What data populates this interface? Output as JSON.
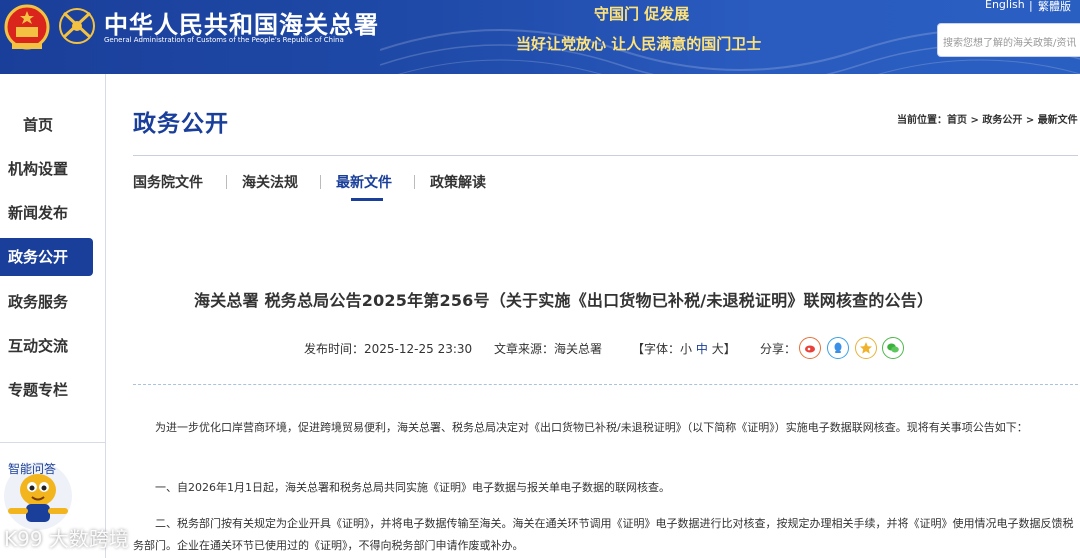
{
  "header": {
    "site_title": "中华人民共和国海关总署",
    "site_subtitle": "General Administration of Customs of the People's Republic of China",
    "slogan_top": "守国门  促发展",
    "slogan_bottom": "当好让党放心   让人民满意的国门卫士",
    "lang_english": "English",
    "lang_separator": "|",
    "lang_traditional": "繁體版",
    "search_placeholder": "搜索您想了解的海关政策/资讯"
  },
  "sidebar": {
    "items": [
      {
        "label": "首页"
      },
      {
        "label": "机构设置"
      },
      {
        "label": "新闻发布"
      },
      {
        "label": "政务公开",
        "active": true
      },
      {
        "label": "政务服务"
      },
      {
        "label": "互动交流"
      },
      {
        "label": "专题专栏"
      }
    ],
    "assistant_label": "智能问答"
  },
  "main": {
    "section_title": "政务公开",
    "breadcrumb": {
      "prefix": "当前位置：",
      "items": [
        "首页",
        "政务公开",
        "最新文件"
      ],
      "separator": " > "
    },
    "tabs": [
      {
        "label": "国务院文件"
      },
      {
        "label": "海关法规"
      },
      {
        "label": "最新文件",
        "active": true
      },
      {
        "label": "政策解读"
      }
    ]
  },
  "article": {
    "title": "海关总署 税务总局公告2025年第256号（关于实施《出口货物已补税/未退税证明》联网核查的公告）",
    "publish_time_label": "发布时间：",
    "publish_time": "2025-12-25 23:30",
    "source_label": "文章来源：",
    "source": "海关总署",
    "font_label": "【字体：",
    "font_small": "小",
    "font_medium": "中",
    "font_large": "大",
    "font_close": "】",
    "share_label": "分享：",
    "share_icons": [
      "weibo-icon",
      "qq-icon",
      "qzone-icon",
      "wechat-icon"
    ],
    "paragraphs": [
      "为进一步优化口岸营商环境，促进跨境贸易便利，海关总署、税务总局决定对《出口货物已补税/未退税证明》（以下简称《证明》）实施电子数据联网核查。现将有关事项公告如下：",
      "一、自2026年1月1日起，海关总署和税务总局共同实施《证明》电子数据与报关单电子数据的联网核查。",
      "二、税务部门按有关规定为企业开具《证明》，并将电子数据传输至海关。海关在通关环节调用《证明》电子数据进行比对核查，按规定办理相关手续，并将《证明》使用情况电子数据反馈税务部门。企业在通关环节已使用过的《证明》，不得向税务部门申请作废或补办。"
    ]
  },
  "watermark": "K99 大数跨境",
  "colors": {
    "brand_blue": "#1a3f9a",
    "slogan_gold": "#ffe37a"
  }
}
